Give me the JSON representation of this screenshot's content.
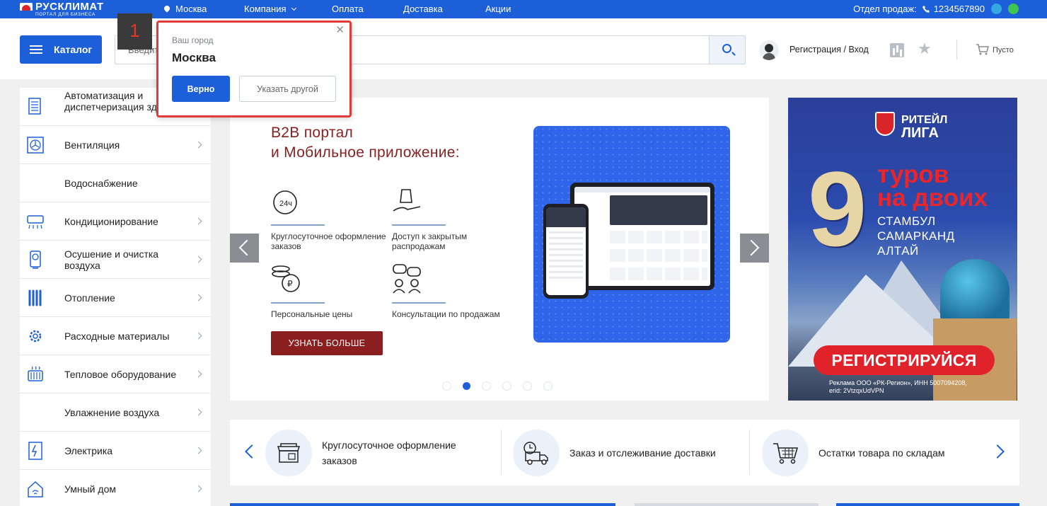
{
  "topbar": {
    "logo_name": "РУСКЛИМАТ",
    "logo_sub": "ПОРТАЛ ДЛЯ БИЗНЕСА",
    "city": "Москва",
    "nav": [
      "Компания",
      "Оплата",
      "Доставка",
      "Акции"
    ],
    "sales_label": "Отдел продаж:",
    "phone": "1234567890",
    "color_brand": "#1c5fd8"
  },
  "header": {
    "catalog_label": "Каталог",
    "search_placeholder": "Введите название, артикул или тег товарной группы",
    "login_label": "Регистрация / Вход",
    "cart_label": "Пусто"
  },
  "sidebar": {
    "items": [
      {
        "label": "Автоматизация и диспетчеризация зданий",
        "icon": "automation-icon"
      },
      {
        "label": "Вентиляция",
        "icon": "ventilation-icon"
      },
      {
        "label": "Водоснабжение",
        "icon": ""
      },
      {
        "label": "Кондиционирование",
        "icon": "air-conditioner-icon"
      },
      {
        "label": "Осушение и очистка воздуха",
        "icon": "air-purifier-icon"
      },
      {
        "label": "Отопление",
        "icon": "radiator-icon"
      },
      {
        "label": "Расходные материалы",
        "icon": "gear-icon"
      },
      {
        "label": "Тепловое оборудование",
        "icon": "heater-icon"
      },
      {
        "label": "Увлажнение воздуха",
        "icon": ""
      },
      {
        "label": "Электрика",
        "icon": "electric-panel-icon"
      },
      {
        "label": "Умный дом",
        "icon": "smart-home-icon"
      }
    ]
  },
  "hero": {
    "title_line1": "B2B портал",
    "title_line2": "и Мобильное приложение:",
    "features": [
      {
        "text": "Круглосуточное оформление заказов",
        "icon": "clock-24h-icon"
      },
      {
        "text": "Доступ к закрытым распродажам",
        "icon": "shopping-bag-hand-icon"
      },
      {
        "text": "Персональные цены",
        "icon": "coins-ruble-icon"
      },
      {
        "text": "Консультации по продажам",
        "icon": "chat-people-icon"
      }
    ],
    "cta": "УЗНАТЬ БОЛЬШЕ",
    "slides_total": 6,
    "active_slide": 2
  },
  "ad": {
    "brand_line1": "РИТЕЙЛ",
    "brand_line2": "ЛИГА",
    "number": "9",
    "headline_line1": "туров",
    "headline_line2": "на двоих",
    "cities": [
      "СТАМБУЛ",
      "САМАРКАНД",
      "АЛТАЙ"
    ],
    "cta": "РЕГИСТРИРУЙСЯ",
    "legal_line1": "Реклама ООО «РК-Регион», ИНН 5007094208,",
    "legal_line2": "erid: 2VtzqxUdVPN"
  },
  "services": [
    {
      "label_line1": "Круглосуточное оформление",
      "label_line2": "заказов",
      "icon": "store-icon"
    },
    {
      "label_line1": "Заказ и отслеживание доставки",
      "label_line2": "",
      "icon": "delivery-truck-icon"
    },
    {
      "label_line1": "Остатки товара по складам",
      "label_line2": "",
      "icon": "cart-icon"
    }
  ],
  "city_popup": {
    "subtitle": "Ваш город",
    "city": "Москва",
    "confirm": "Верно",
    "other": "Указать другой"
  },
  "step_badge": "1"
}
